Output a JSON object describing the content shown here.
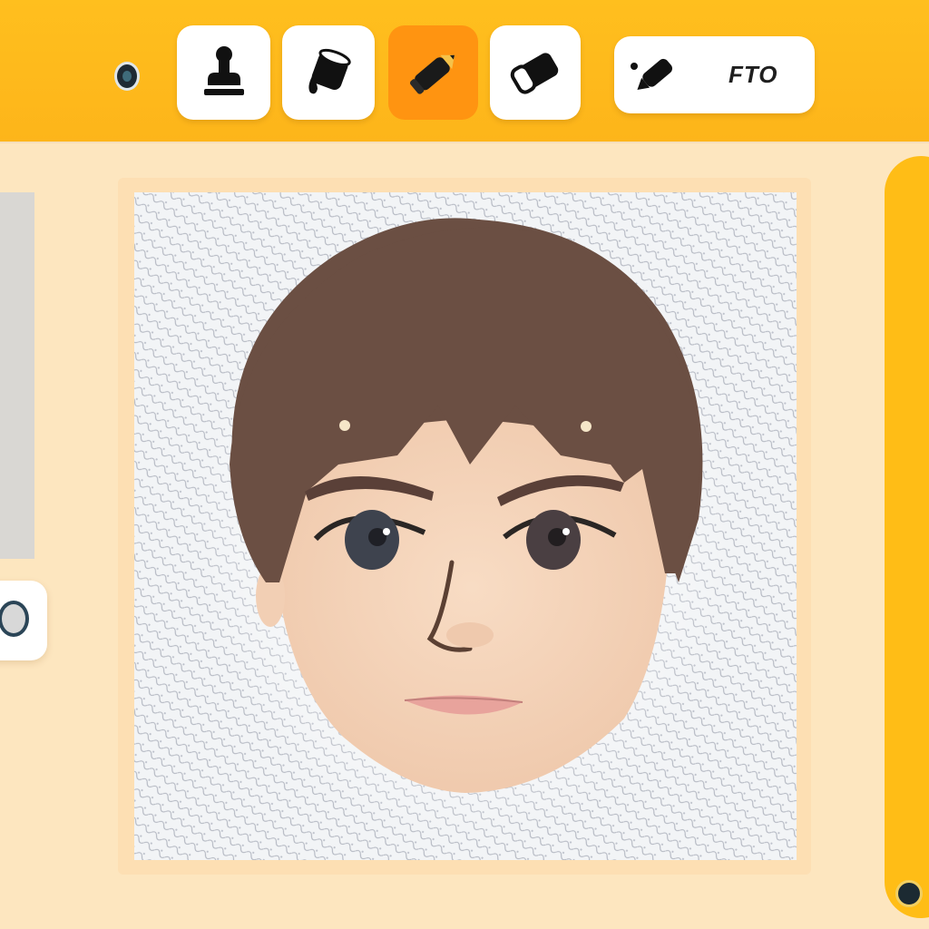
{
  "toolbar": {
    "tools": [
      {
        "name": "stamp",
        "icon": "stamp-icon"
      },
      {
        "name": "fill",
        "icon": "paint-bucket-icon"
      },
      {
        "name": "pencil",
        "icon": "pencil-icon",
        "active": true
      },
      {
        "name": "eraser",
        "icon": "eraser-icon"
      },
      {
        "name": "brush",
        "icon": "marker-icon",
        "label": "FTO"
      }
    ]
  },
  "colors": {
    "toolbar_bg": "#ffbf1e",
    "active_tool": "#ff9411",
    "workspace_bg": "#fde6bf",
    "hair": "#6b4f43",
    "skin": "#f6d6bd"
  },
  "canvas": {
    "content": "avatar-face"
  }
}
